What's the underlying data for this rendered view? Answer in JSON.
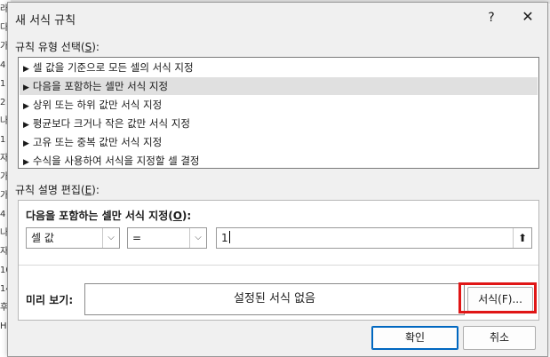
{
  "background": {
    "cells": [
      "라",
      "다",
      "가",
      "4",
      "1",
      "2",
      "나",
      "1",
      "자",
      "가",
      "가",
      "4",
      "나",
      "자",
      "10",
      "14",
      "후",
      "H"
    ]
  },
  "dialog": {
    "title": "새 서식 규칙",
    "help_label": "?",
    "close_label": "✕"
  },
  "rule_type": {
    "label": "규칙 유형 선택(",
    "mnemonic": "S",
    "label_end": "):",
    "items": [
      "셀 값을 기준으로 모든 셀의 서식 지정",
      "다음을 포함하는 셀만 서식 지정",
      "상위 또는 하위 값만 서식 지정",
      "평균보다 크거나 작은 값만 서식 지정",
      "고유 또는 중복 값만 서식 지정",
      "수식을 사용하여 서식을 지정할 셀 결정"
    ],
    "selected_index": 1
  },
  "rule_desc": {
    "label": "규칙 설명 편집(",
    "mnemonic": "E",
    "label_end": "):",
    "heading": "다음을 포함하는 셀만 서식 지정(",
    "heading_mnemonic": "O",
    "heading_end": "):",
    "combo1": "셀 값",
    "combo2": "=",
    "value": "1",
    "preview_label": "미리 보기:",
    "preview_text": "설정된 서식 없음",
    "format_button": "서식(F)..."
  },
  "buttons": {
    "ok": "확인",
    "cancel": "취소"
  },
  "colors": {
    "highlight_box": "#e01616",
    "primary_border": "#0067c0",
    "selected_item_bg": "#e0e0e0"
  }
}
